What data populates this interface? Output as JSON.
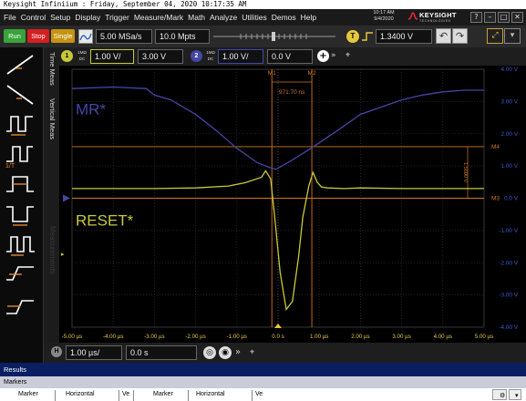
{
  "title_bar": "Keysight Infiniium : Friday, September 04, 2020 10:17:35 AM",
  "menu": [
    "File",
    "Control",
    "Setup",
    "Display",
    "Trigger",
    "Measure/Mark",
    "Math",
    "Analyze",
    "Utilities",
    "Demos",
    "Help"
  ],
  "clock": {
    "time": "10:17 AM",
    "date": "9/4/2020"
  },
  "brand": {
    "name": "KEYSIGHT",
    "sub": "TECHNOLOGIES"
  },
  "window_buttons": [
    "?",
    "–",
    "□",
    "✕"
  ],
  "toolbar": {
    "run": "Run",
    "stop": "Stop",
    "single": "Single",
    "sample_rate": "5.00 MSa/s",
    "memory_depth": "10.0 Mpts",
    "trigger_badge": "T",
    "trigger_level": "1.3400 V"
  },
  "colors": {
    "ch1": "#c8c83c",
    "ch2": "#4646a6",
    "marker": "#d2781e",
    "run": "#3aa33a",
    "stop": "#d42020",
    "single": "#c59410",
    "axis_right": "#3c5ad2",
    "axis_bottom": "#e6c83c"
  },
  "channels": {
    "ch1": {
      "badge": "1",
      "coupling_top": "1MΩ",
      "coupling_bot": "DC",
      "scale": "1.00 V/",
      "offset": "3.00 V"
    },
    "ch2": {
      "badge": "2",
      "coupling_top": "1MΩ",
      "coupling_bot": "DC",
      "scale": "1.00 V/",
      "offset": "0.0 V"
    }
  },
  "side_tabs": [
    "Time Meas",
    "Vertical Meas",
    "Measurements"
  ],
  "timebase": {
    "badge": "H",
    "scale": "1.00 µs/",
    "position": "0.0 s"
  },
  "waveform_labels": {
    "ch2": "MR*",
    "ch1": "RESET*"
  },
  "markers": {
    "m1": "M1",
    "m2": "M2",
    "m3": "M3",
    "m4": "M4",
    "delta_t": "971.70 ns",
    "delta_v": "1.5600 V"
  },
  "results": {
    "title": "Results",
    "tab": "Markers",
    "columns": [
      "Marker",
      "Horizontal",
      "Ve",
      "Marker",
      "Horizontal",
      "Ve"
    ]
  },
  "chart_data": {
    "type": "line",
    "x_unit": "µs",
    "y_unit": "V",
    "xlim": [
      -5,
      5
    ],
    "ylim": [
      -4,
      4
    ],
    "x_ticks": [
      "-5.00 µs",
      "-4.00 µs",
      "-3.00 µs",
      "-2.00 µs",
      "-1.00 µs",
      "0.0 s",
      "1.00 µs",
      "2.00 µs",
      "3.00 µs",
      "4.00 µs",
      "5.00 µs"
    ],
    "y_ticks": [
      "4.00 V",
      "3.00 V",
      "2.00 V",
      "1.00 V",
      "0.0 V",
      "-1.00 V",
      "-2.00 V",
      "-3.00 V",
      "-4.00 V"
    ],
    "x_tick_values": [
      -5,
      -4,
      -3,
      -2,
      -1,
      0,
      1,
      2,
      3,
      4,
      5
    ],
    "y_tick_values": [
      4,
      3,
      2,
      1,
      0,
      -1,
      -2,
      -3,
      -4
    ],
    "markers": {
      "m1_x": -0.15,
      "m2_x": 0.82,
      "m3_y": 0.0,
      "m4_y": 1.6
    },
    "series": [
      {
        "name": "MR*",
        "channel": 2,
        "x": [
          -5.0,
          -4.0,
          -3.2,
          -3.0,
          -2.6,
          -2.0,
          -1.5,
          -1.0,
          -0.5,
          -0.2,
          -0.05,
          0.3,
          0.8,
          1.5,
          2.0,
          3.0,
          3.5,
          4.0,
          4.5,
          5.0
        ],
        "y": [
          3.4,
          3.45,
          3.4,
          3.2,
          3.05,
          2.6,
          2.1,
          1.55,
          1.1,
          0.95,
          0.9,
          1.15,
          1.55,
          2.15,
          2.6,
          3.05,
          3.2,
          3.3,
          3.35,
          3.35
        ]
      },
      {
        "name": "RESET*",
        "channel": 1,
        "x": [
          -5.0,
          -4.0,
          -3.0,
          -2.0,
          -1.2,
          -0.8,
          -0.4,
          -0.3,
          -0.18,
          -0.08,
          0.05,
          0.2,
          0.35,
          0.5,
          0.6,
          0.75,
          0.85,
          0.95,
          1.05,
          1.2,
          1.6,
          2.0,
          3.0,
          4.0,
          5.0
        ],
        "y": [
          0.3,
          0.3,
          0.3,
          0.32,
          0.38,
          0.48,
          0.65,
          0.85,
          0.6,
          -0.6,
          -2.3,
          -3.45,
          -3.2,
          -1.8,
          -0.6,
          0.4,
          0.8,
          0.5,
          0.35,
          0.32,
          0.3,
          0.32,
          0.3,
          0.3,
          0.3
        ]
      }
    ]
  }
}
